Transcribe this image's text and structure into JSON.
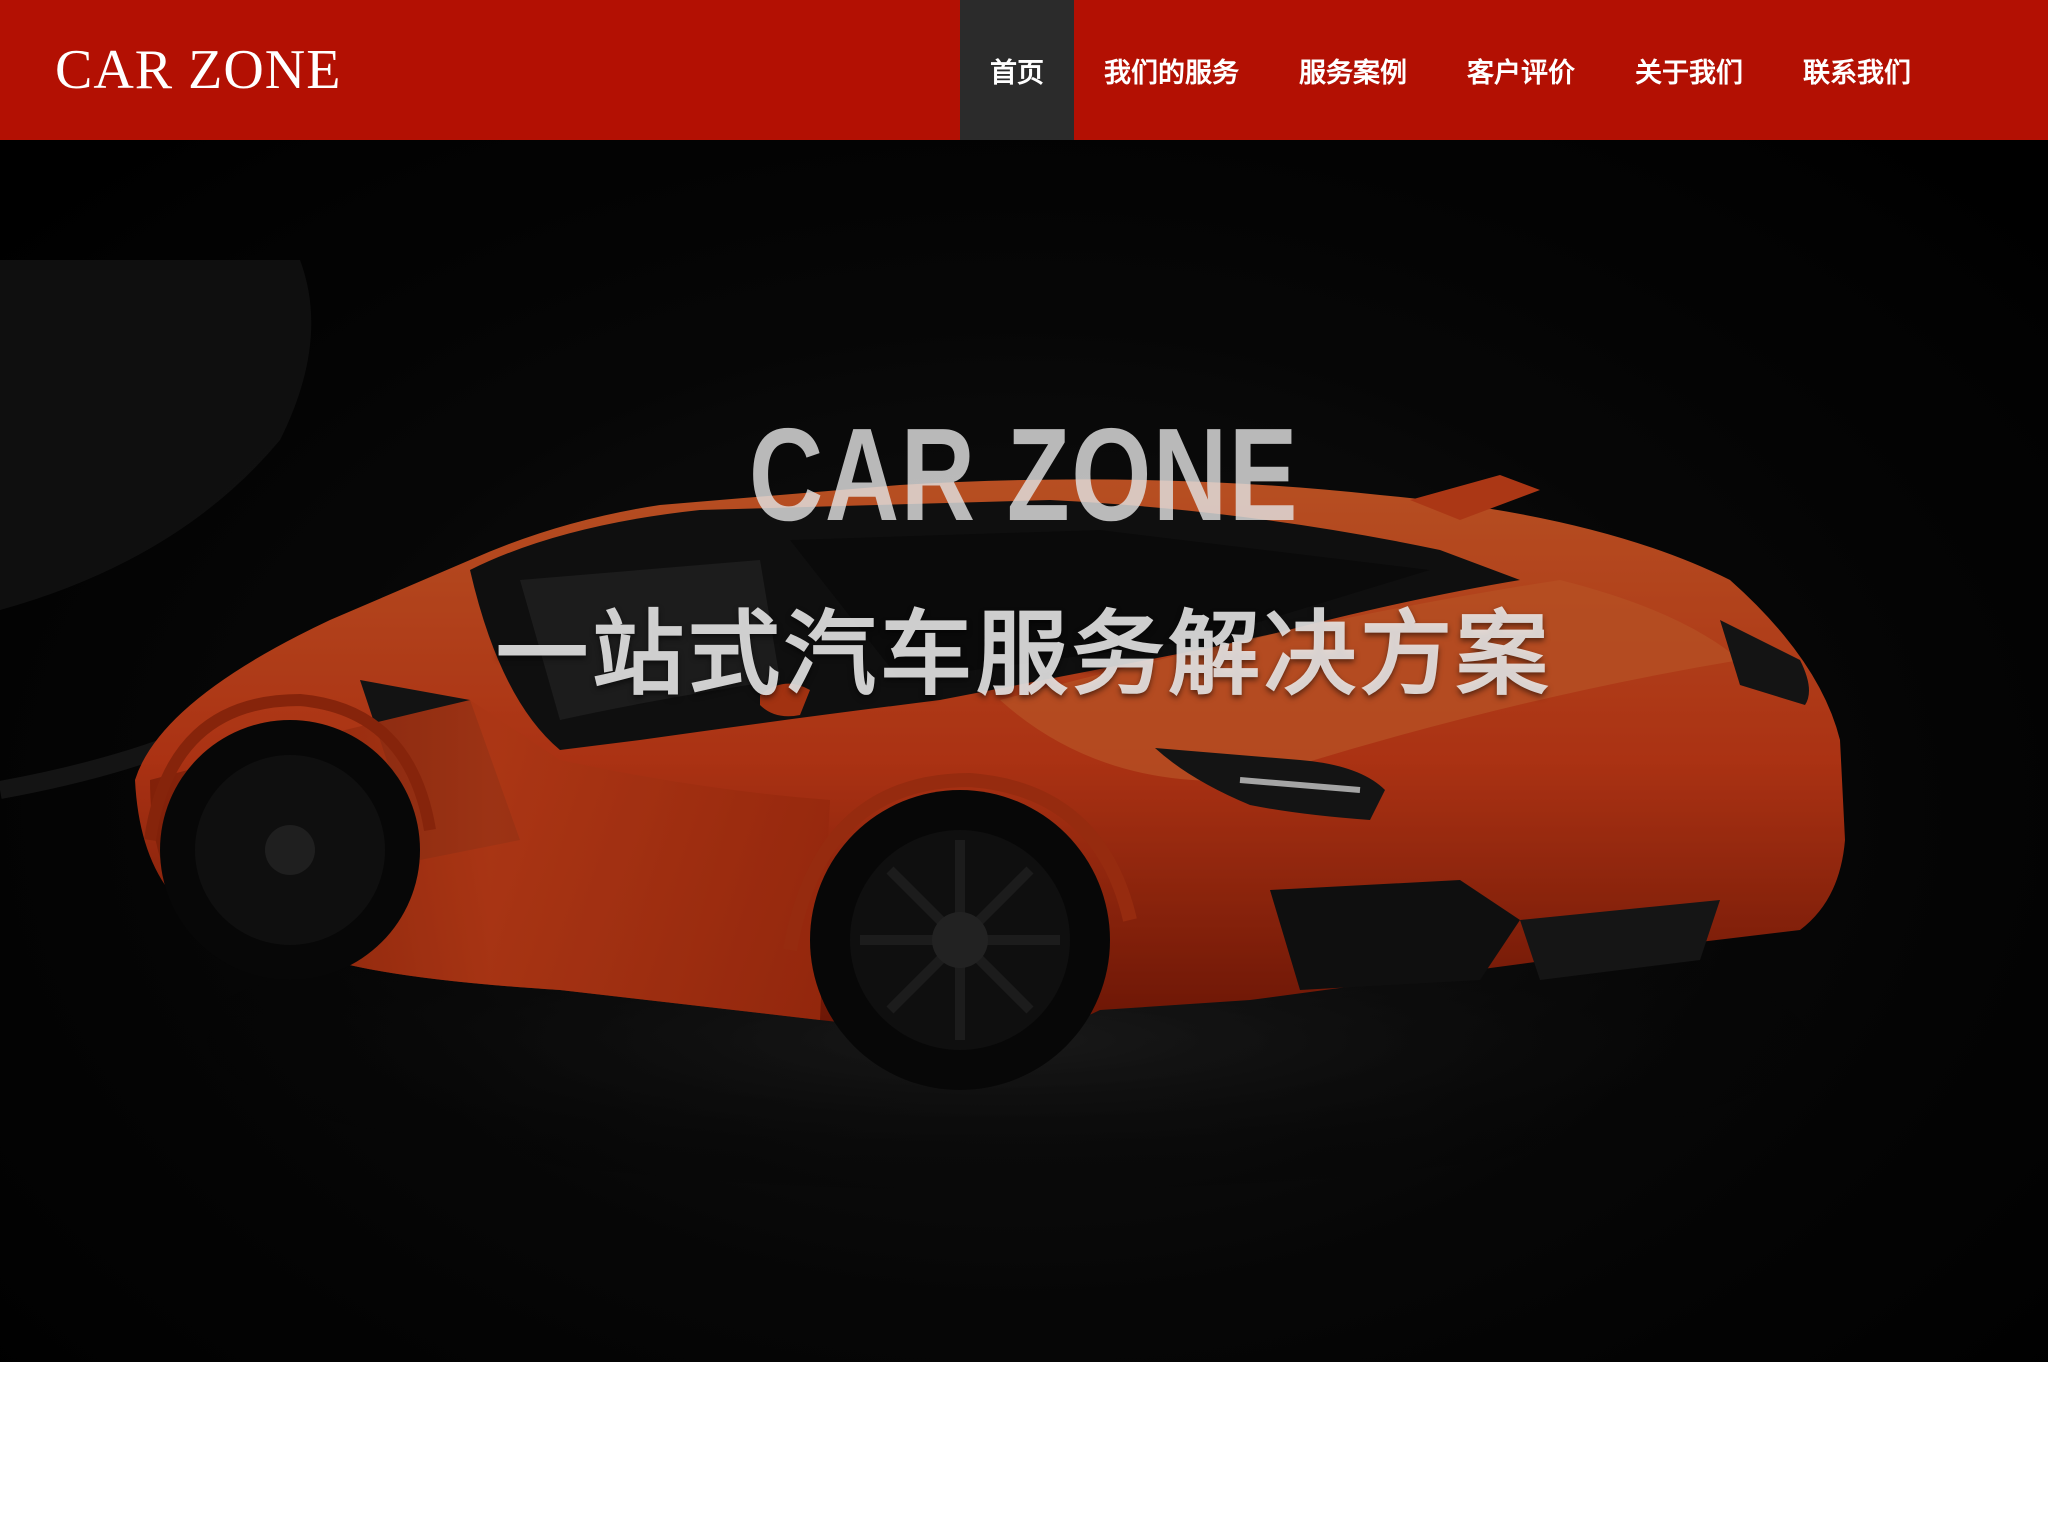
{
  "header": {
    "logo_text": "CAR ZONE",
    "brand_color": "#b31003",
    "active_color": "#2b2b2b",
    "nav": [
      {
        "label": "首页",
        "active": true
      },
      {
        "label": "我们的服务",
        "active": false
      },
      {
        "label": "服务案例",
        "active": false
      },
      {
        "label": "客户评价",
        "active": false
      },
      {
        "label": "关于我们",
        "active": false
      },
      {
        "label": "联系我们",
        "active": false
      }
    ]
  },
  "hero": {
    "title": "CAR ZONE",
    "subtitle": "一站式汽车服务解决方案",
    "background_image": "orange-sports-car",
    "car_color": "#e8461a"
  }
}
